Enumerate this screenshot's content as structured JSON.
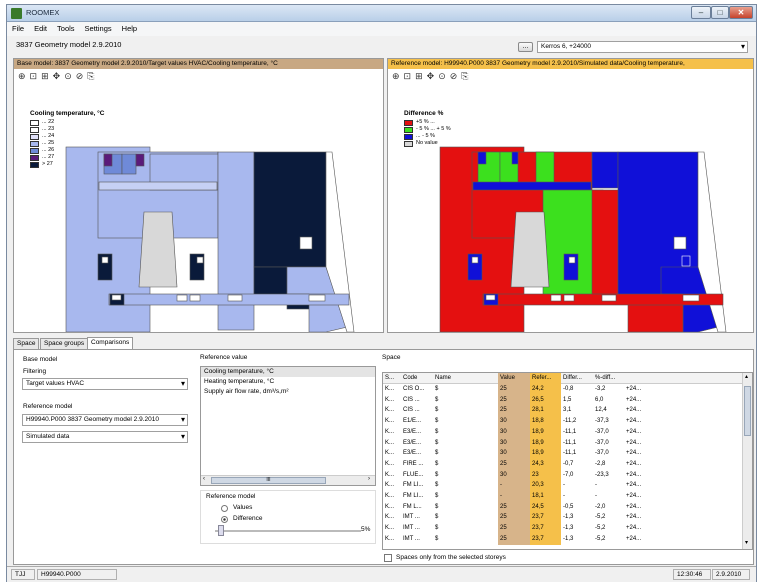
{
  "window": {
    "title": "ROOMEX",
    "controls": [
      "–",
      "□",
      "✕"
    ]
  },
  "menu": [
    "File",
    "Edit",
    "Tools",
    "Settings",
    "Help"
  ],
  "model_field": "3837 Geometry model  2.9.2010",
  "browse_button": "...",
  "storey_select": "Kerros 6, +24000",
  "left_view": {
    "header": "Base model: 3837 Geometry model 2.9.2010/Target values HVAC/Cooling temperature, °C",
    "header_color": "#c8a883",
    "tools": [
      "zoom-icon",
      "zoom-region-icon",
      "zoom-extent-icon",
      "pan-icon",
      "zoom-in-icon",
      "zoom-out-icon",
      "copy-icon"
    ],
    "legend_title": "Cooling temperature, °C",
    "legend": [
      {
        "label": "... 22",
        "color": "#ffffff"
      },
      {
        "label": "... 23",
        "color": "#ffffff"
      },
      {
        "label": "... 24",
        "color": "#e0e0f8"
      },
      {
        "label": "... 25",
        "color": "#a8b8ee"
      },
      {
        "label": "... 26",
        "color": "#6f8ad8"
      },
      {
        "label": "... 27",
        "color": "#5a1a7a"
      },
      {
        "label": "> 27",
        "color": "#0a1a3a"
      }
    ]
  },
  "right_view": {
    "header": "Reference model: H99940.P000 3837 Geometry model 2.9.2010/Simulated data/Cooling temperature,",
    "header_color": "#f5c04a",
    "tools": [
      "zoom-icon",
      "zoom-region-icon",
      "zoom-extent-icon",
      "pan-icon",
      "zoom-in-icon",
      "zoom-out-icon",
      "copy-icon"
    ],
    "legend_title": "Difference %",
    "legend": [
      {
        "label": "+5 % ...",
        "color": "#e41010"
      },
      {
        "label": "- 5 % ... + 5 %",
        "color": "#3ce01e"
      },
      {
        "label": "... - 5 %",
        "color": "#1010d8"
      },
      {
        "label": "No value",
        "color": "#d8d8d8"
      }
    ]
  },
  "tabs": [
    "Space",
    "Space groups",
    "Comparisons"
  ],
  "active_tab": "Comparisons",
  "base_model": {
    "group_label": "Base model",
    "filtering_label": "Filtering",
    "filtering_value": "Target values HVAC",
    "reference_label": "Reference model",
    "reference_value": "H99940.P000 3837 Geometry model 2.9.2010",
    "data_value": "Simulated data"
  },
  "reference_value": {
    "label": "Reference value",
    "items": [
      "Cooling temperature, °C",
      "Heating temperature, °C",
      "Supply air flow rate, dm³/s,m²"
    ],
    "selected": 0,
    "scroll_mark": "III"
  },
  "reference_model_group": {
    "label": "Reference model",
    "options": [
      "Values",
      "Difference"
    ],
    "selected": 1,
    "slider_value": "5%"
  },
  "space_table": {
    "label": "Space",
    "columns": [
      "S...",
      "Code",
      "Name",
      "Value",
      "Refer...",
      "Differ...",
      "%-diff...",
      ""
    ],
    "rows": [
      [
        "K...",
        "CIS O...",
        "$",
        "25",
        "24,2",
        "-0,8",
        "-3,2",
        "+24..."
      ],
      [
        "K...",
        "CIS ...",
        "$",
        "25",
        "26,5",
        "1,5",
        "6,0",
        "+24..."
      ],
      [
        "K...",
        "CIS ...",
        "$",
        "25",
        "28,1",
        "3,1",
        "12,4",
        "+24..."
      ],
      [
        "K...",
        "E1/E...",
        "$",
        "30",
        "18,8",
        "-11,2",
        "-37,3",
        "+24..."
      ],
      [
        "K...",
        "E3/E...",
        "$",
        "30",
        "18,9",
        "-11,1",
        "-37,0",
        "+24..."
      ],
      [
        "K...",
        "E3/E...",
        "$",
        "30",
        "18,9",
        "-11,1",
        "-37,0",
        "+24..."
      ],
      [
        "K...",
        "E3/E...",
        "$",
        "30",
        "18,9",
        "-11,1",
        "-37,0",
        "+24..."
      ],
      [
        "K...",
        "FIRE ...",
        "$",
        "25",
        "24,3",
        "-0,7",
        "-2,8",
        "+24..."
      ],
      [
        "K...",
        "FLUE...",
        "$",
        "30",
        "23",
        "-7,0",
        "-23,3",
        "+24..."
      ],
      [
        "K...",
        "FM LI...",
        "$",
        "-",
        "20,3",
        "-",
        "-",
        "+24..."
      ],
      [
        "K...",
        "FM LI...",
        "$",
        "-",
        "18,1",
        "-",
        "-",
        "+24..."
      ],
      [
        "K...",
        "FM L...",
        "$",
        "25",
        "24,5",
        "-0,5",
        "-2,0",
        "+24..."
      ],
      [
        "K...",
        "IMT ...",
        "$",
        "25",
        "23,7",
        "-1,3",
        "-5,2",
        "+24..."
      ],
      [
        "K...",
        "IMT ...",
        "$",
        "25",
        "23,7",
        "-1,3",
        "-5,2",
        "+24..."
      ],
      [
        "K...",
        "IMT ...",
        "$",
        "25",
        "23,7",
        "-1,3",
        "-5,2",
        "+24..."
      ]
    ],
    "value_col_color": "#d7b48a",
    "ref_col_color": "#f5c04a",
    "checkbox_label": "Spaces only from the selected storeys"
  },
  "status": {
    "user": "TJJ",
    "project": "H99940.P000",
    "time": "12:30:46",
    "date": "2.9.2010"
  }
}
